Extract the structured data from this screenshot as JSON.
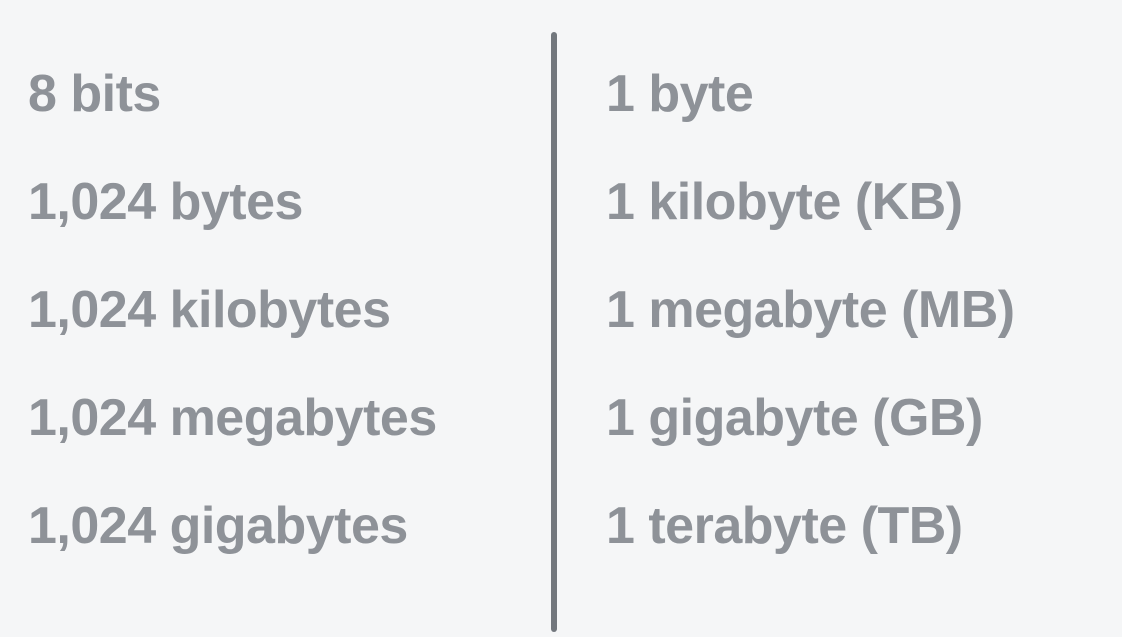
{
  "units_table": {
    "left_column": [
      "8 bits",
      "1,024 bytes",
      "1,024 kilobytes",
      "1,024 megabytes",
      "1,024 gigabytes"
    ],
    "right_column": [
      "1 byte",
      "1 kilobyte (KB)",
      "1 megabyte (MB)",
      "1 gigabyte (GB)",
      "1 terabyte (TB)"
    ]
  },
  "colors": {
    "background": "#f5f6f7",
    "text": "#8e9298",
    "divider": "#72777d"
  }
}
